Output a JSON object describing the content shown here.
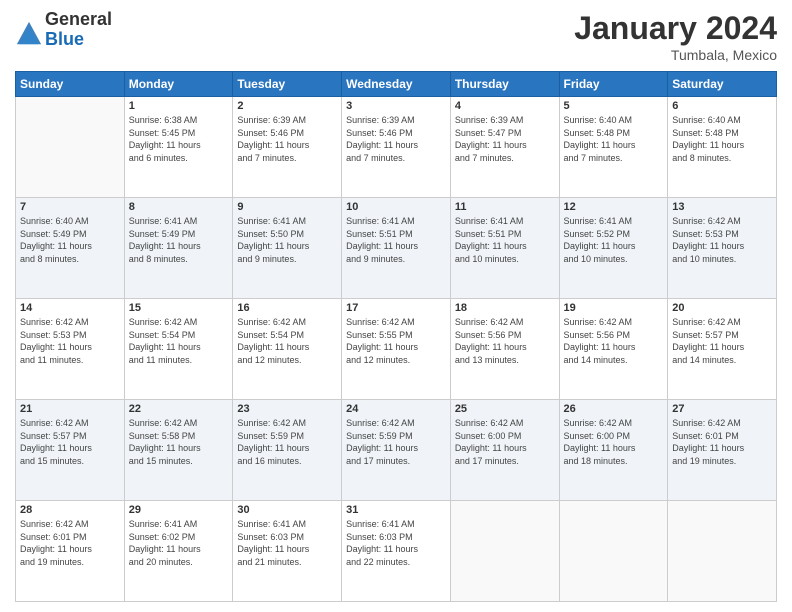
{
  "header": {
    "logo_general": "General",
    "logo_blue": "Blue",
    "title": "January 2024",
    "subtitle": "Tumbala, Mexico"
  },
  "weekdays": [
    "Sunday",
    "Monday",
    "Tuesday",
    "Wednesday",
    "Thursday",
    "Friday",
    "Saturday"
  ],
  "weeks": [
    [
      {
        "day": "",
        "info": ""
      },
      {
        "day": "1",
        "info": "Sunrise: 6:38 AM\nSunset: 5:45 PM\nDaylight: 11 hours\nand 6 minutes."
      },
      {
        "day": "2",
        "info": "Sunrise: 6:39 AM\nSunset: 5:46 PM\nDaylight: 11 hours\nand 7 minutes."
      },
      {
        "day": "3",
        "info": "Sunrise: 6:39 AM\nSunset: 5:46 PM\nDaylight: 11 hours\nand 7 minutes."
      },
      {
        "day": "4",
        "info": "Sunrise: 6:39 AM\nSunset: 5:47 PM\nDaylight: 11 hours\nand 7 minutes."
      },
      {
        "day": "5",
        "info": "Sunrise: 6:40 AM\nSunset: 5:48 PM\nDaylight: 11 hours\nand 7 minutes."
      },
      {
        "day": "6",
        "info": "Sunrise: 6:40 AM\nSunset: 5:48 PM\nDaylight: 11 hours\nand 8 minutes."
      }
    ],
    [
      {
        "day": "7",
        "info": "Sunrise: 6:40 AM\nSunset: 5:49 PM\nDaylight: 11 hours\nand 8 minutes."
      },
      {
        "day": "8",
        "info": "Sunrise: 6:41 AM\nSunset: 5:49 PM\nDaylight: 11 hours\nand 8 minutes."
      },
      {
        "day": "9",
        "info": "Sunrise: 6:41 AM\nSunset: 5:50 PM\nDaylight: 11 hours\nand 9 minutes."
      },
      {
        "day": "10",
        "info": "Sunrise: 6:41 AM\nSunset: 5:51 PM\nDaylight: 11 hours\nand 9 minutes."
      },
      {
        "day": "11",
        "info": "Sunrise: 6:41 AM\nSunset: 5:51 PM\nDaylight: 11 hours\nand 10 minutes."
      },
      {
        "day": "12",
        "info": "Sunrise: 6:41 AM\nSunset: 5:52 PM\nDaylight: 11 hours\nand 10 minutes."
      },
      {
        "day": "13",
        "info": "Sunrise: 6:42 AM\nSunset: 5:53 PM\nDaylight: 11 hours\nand 10 minutes."
      }
    ],
    [
      {
        "day": "14",
        "info": "Sunrise: 6:42 AM\nSunset: 5:53 PM\nDaylight: 11 hours\nand 11 minutes."
      },
      {
        "day": "15",
        "info": "Sunrise: 6:42 AM\nSunset: 5:54 PM\nDaylight: 11 hours\nand 11 minutes."
      },
      {
        "day": "16",
        "info": "Sunrise: 6:42 AM\nSunset: 5:54 PM\nDaylight: 11 hours\nand 12 minutes."
      },
      {
        "day": "17",
        "info": "Sunrise: 6:42 AM\nSunset: 5:55 PM\nDaylight: 11 hours\nand 12 minutes."
      },
      {
        "day": "18",
        "info": "Sunrise: 6:42 AM\nSunset: 5:56 PM\nDaylight: 11 hours\nand 13 minutes."
      },
      {
        "day": "19",
        "info": "Sunrise: 6:42 AM\nSunset: 5:56 PM\nDaylight: 11 hours\nand 14 minutes."
      },
      {
        "day": "20",
        "info": "Sunrise: 6:42 AM\nSunset: 5:57 PM\nDaylight: 11 hours\nand 14 minutes."
      }
    ],
    [
      {
        "day": "21",
        "info": "Sunrise: 6:42 AM\nSunset: 5:57 PM\nDaylight: 11 hours\nand 15 minutes."
      },
      {
        "day": "22",
        "info": "Sunrise: 6:42 AM\nSunset: 5:58 PM\nDaylight: 11 hours\nand 15 minutes."
      },
      {
        "day": "23",
        "info": "Sunrise: 6:42 AM\nSunset: 5:59 PM\nDaylight: 11 hours\nand 16 minutes."
      },
      {
        "day": "24",
        "info": "Sunrise: 6:42 AM\nSunset: 5:59 PM\nDaylight: 11 hours\nand 17 minutes."
      },
      {
        "day": "25",
        "info": "Sunrise: 6:42 AM\nSunset: 6:00 PM\nDaylight: 11 hours\nand 17 minutes."
      },
      {
        "day": "26",
        "info": "Sunrise: 6:42 AM\nSunset: 6:00 PM\nDaylight: 11 hours\nand 18 minutes."
      },
      {
        "day": "27",
        "info": "Sunrise: 6:42 AM\nSunset: 6:01 PM\nDaylight: 11 hours\nand 19 minutes."
      }
    ],
    [
      {
        "day": "28",
        "info": "Sunrise: 6:42 AM\nSunset: 6:01 PM\nDaylight: 11 hours\nand 19 minutes."
      },
      {
        "day": "29",
        "info": "Sunrise: 6:41 AM\nSunset: 6:02 PM\nDaylight: 11 hours\nand 20 minutes."
      },
      {
        "day": "30",
        "info": "Sunrise: 6:41 AM\nSunset: 6:03 PM\nDaylight: 11 hours\nand 21 minutes."
      },
      {
        "day": "31",
        "info": "Sunrise: 6:41 AM\nSunset: 6:03 PM\nDaylight: 11 hours\nand 22 minutes."
      },
      {
        "day": "",
        "info": ""
      },
      {
        "day": "",
        "info": ""
      },
      {
        "day": "",
        "info": ""
      }
    ]
  ]
}
